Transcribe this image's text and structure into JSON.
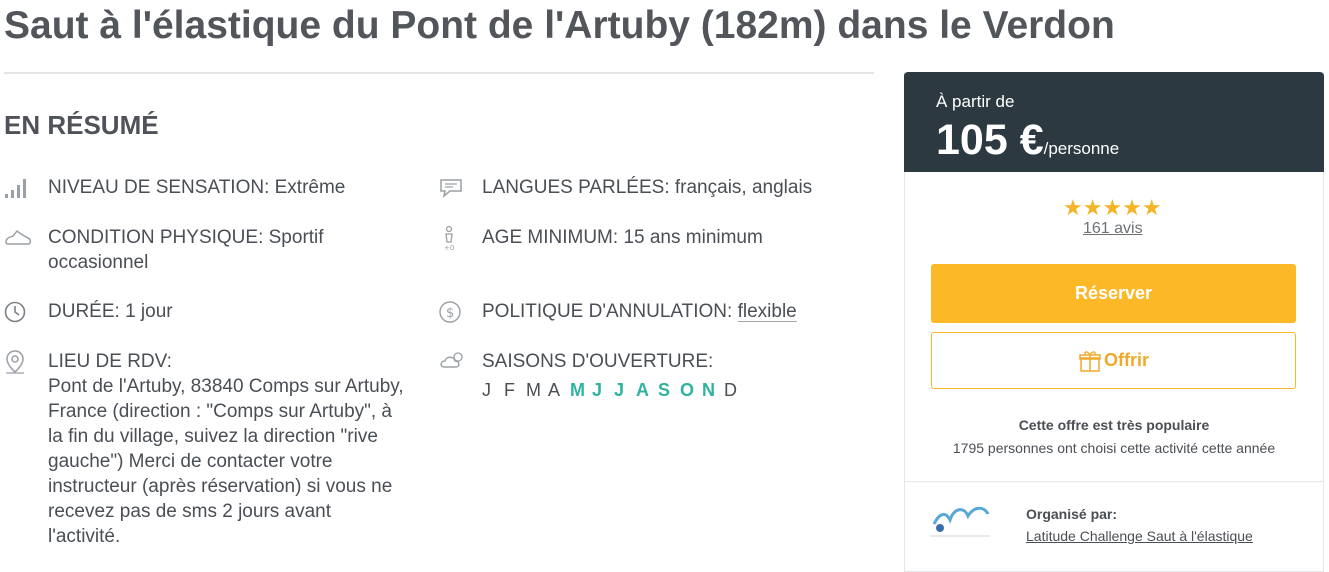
{
  "title": "Saut à l'élastique du Pont de l'Artuby (182m) dans le Verdon",
  "summary": {
    "heading": "EN RÉSUMÉ",
    "sensation": "NIVEAU DE SENSATION: Extrême",
    "condition": "CONDITION PHYSIQUE: Sportif occasionnel",
    "duration": "DURÉE: 1 jour",
    "meeting_label": "LIEU DE RDV:",
    "meeting_text": "Pont de l'Artuby, 83840 Comps sur Artuby, France (direction : \"Comps sur Artuby\", à la fin du village, suivez la direction \"rive gauche\") Merci de contacter votre instructeur (après réservation) si vous ne recevez pas de sms 2 jours avant l'activité.",
    "languages": "LANGUES PARLÉES: français, anglais",
    "age": "AGE MINIMUM: 15 ans minimum",
    "cancel_label": "POLITIQUE D'ANNULATION: ",
    "cancel_value": "flexible",
    "seasons_label": "SAISONS D'OUVERTURE:",
    "months": [
      {
        "letter": "J",
        "active": false
      },
      {
        "letter": "F",
        "active": false
      },
      {
        "letter": "M",
        "active": false
      },
      {
        "letter": "A",
        "active": false
      },
      {
        "letter": "M",
        "active": true
      },
      {
        "letter": "J",
        "active": true
      },
      {
        "letter": "J",
        "active": true
      },
      {
        "letter": "A",
        "active": true
      },
      {
        "letter": "S",
        "active": true
      },
      {
        "letter": "O",
        "active": true
      },
      {
        "letter": "N",
        "active": true
      },
      {
        "letter": "D",
        "active": false
      }
    ]
  },
  "booking": {
    "from_label": "À partir de",
    "price": "105 €",
    "per": "/personne",
    "stars": "★★★★★",
    "reviews": "161 avis",
    "reserve_label": "Réserver",
    "offer_label": "Offrir",
    "popular_title": "Cette offre est très populaire",
    "popular_sub": "1795 personnes ont choisi cette activité cette année",
    "organized_label": "Organisé par:",
    "organizer": "Latitude Challenge Saut à l'élastique"
  },
  "colors": {
    "accent": "#fdb827",
    "dark": "#2d3940",
    "month_active": "#2fb3a0"
  }
}
